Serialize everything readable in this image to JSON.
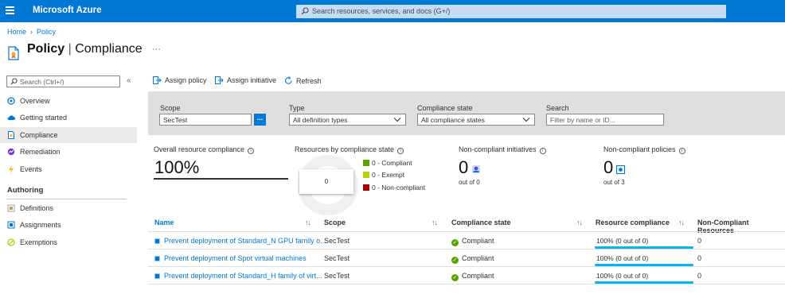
{
  "topbar": {
    "brand": "Microsoft Azure",
    "search_placeholder": "Search resources, services, and docs (G+/)"
  },
  "breadcrumb": {
    "home": "Home",
    "policy": "Policy"
  },
  "page": {
    "title_bold": "Policy",
    "title_sep": " | ",
    "title_rest": "Compliance",
    "more": "···"
  },
  "sidebar": {
    "search_placeholder": "Search (Ctrl+/)",
    "collapse": "«",
    "items": [
      {
        "label": "Overview",
        "icon": "overview-icon"
      },
      {
        "label": "Getting started",
        "icon": "cloud-icon"
      },
      {
        "label": "Compliance",
        "icon": "compliance-icon",
        "active": true
      },
      {
        "label": "Remediation",
        "icon": "remediation-icon"
      },
      {
        "label": "Events",
        "icon": "lightning-icon"
      }
    ],
    "section": "Authoring",
    "authoring_items": [
      {
        "label": "Definitions",
        "icon": "definitions-icon"
      },
      {
        "label": "Assignments",
        "icon": "assignments-icon"
      },
      {
        "label": "Exemptions",
        "icon": "exemptions-icon"
      }
    ]
  },
  "commands": {
    "assign_policy": "Assign policy",
    "assign_initiative": "Assign initiative",
    "refresh": "Refresh"
  },
  "filters": {
    "scope_label": "Scope",
    "scope_value": "SecTest",
    "scope_button": "...",
    "type_label": "Type",
    "type_value": "All definition types",
    "state_label": "Compliance state",
    "state_value": "All compliance states",
    "search_label": "Search",
    "search_placeholder": "Filter by name or ID..."
  },
  "summary": {
    "overall_label": "Overall resource compliance",
    "overall_value": "100%",
    "by_state_label": "Resources by compliance state",
    "donut_total": "0",
    "legend": [
      {
        "label": "0 - Compliant",
        "color": "#57a300"
      },
      {
        "label": "0 - Exempt",
        "color": "#b4d300"
      },
      {
        "label": "0 - Non-compliant",
        "color": "#a80000"
      }
    ],
    "initiatives_label": "Non-compliant initiatives",
    "initiatives_value": "0",
    "initiatives_outof": "out of 0",
    "policies_label": "Non-compliant policies",
    "policies_value": "0",
    "policies_outof": "out of 3"
  },
  "table": {
    "columns": {
      "name": "Name",
      "scope": "Scope",
      "state": "Compliance state",
      "resource": "Resource compliance",
      "noncompliant": "Non-Compliant Resources"
    },
    "sort_glyph": "↑↓",
    "rows": [
      {
        "name": "Prevent deployment of Standard_N GPU family o...",
        "scope": "SecTest",
        "state": "Compliant",
        "resource": "100% (0 out of 0)",
        "noncompliant": "0"
      },
      {
        "name": "Prevent deployment of Spot virtual machines",
        "scope": "SecTest",
        "state": "Compliant",
        "resource": "100% (0 out of 0)",
        "noncompliant": "0"
      },
      {
        "name": "Prevent deployment of Standard_H family of virt...",
        "scope": "SecTest",
        "state": "Compliant",
        "resource": "100% (0 out of 0)",
        "noncompliant": "0"
      }
    ]
  },
  "colors": {
    "accent": "#0078d4",
    "compliant": "#57a300",
    "bar": "#00b7f0"
  }
}
